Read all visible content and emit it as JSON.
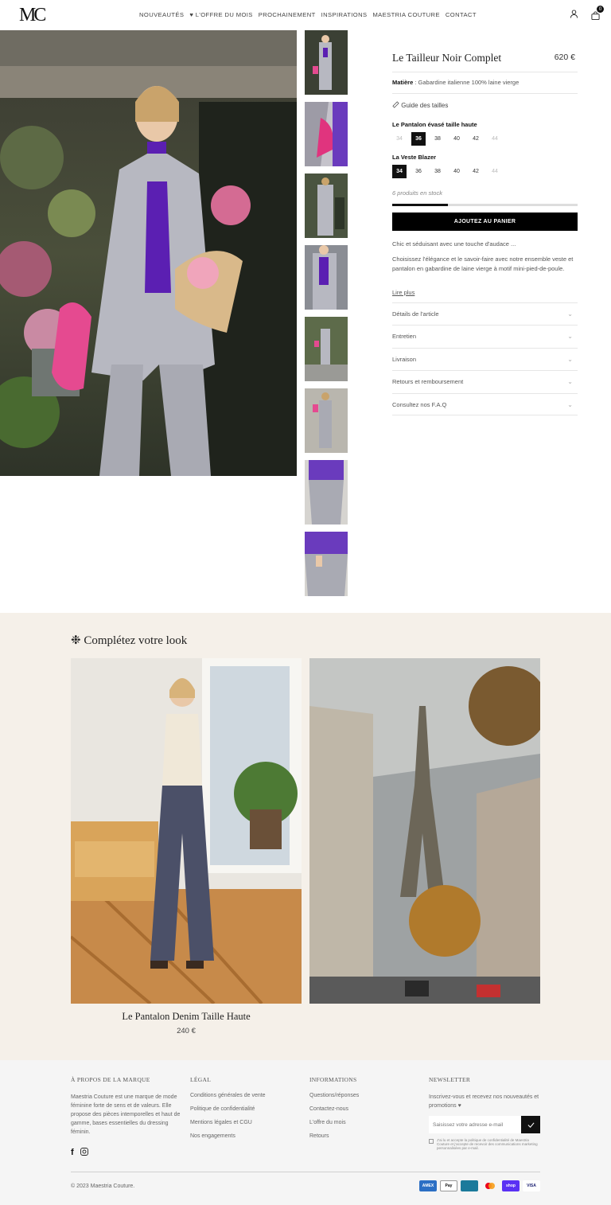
{
  "header": {
    "logo": "MC",
    "nav": [
      "NOUVEAUTÉS",
      "♥ L'OFFRE DU MOIS",
      "PROCHAINEMENT",
      "INSPIRATIONS",
      "MAESTRIA COUTURE",
      "CONTACT"
    ],
    "cart_count": "0"
  },
  "product": {
    "title": "Le Tailleur Noir Complet",
    "price": "620 €",
    "material_label": "Matière",
    "material_value": " : Gabardine italienne 100% laine vierge",
    "size_guide": "Guide des tailles",
    "variant1": {
      "label": "Le Pantalon évasé taille haute",
      "sizes": [
        "34",
        "36",
        "38",
        "40",
        "42",
        "44"
      ],
      "selected": "36",
      "unavailable": [
        "34",
        "44"
      ]
    },
    "variant2": {
      "label": "La Veste Blazer",
      "sizes": [
        "34",
        "36",
        "38",
        "40",
        "42",
        "44"
      ],
      "selected": "34",
      "unavailable": [
        "44"
      ]
    },
    "stock": "6 produits en stock",
    "stock_fraction": 0.3,
    "add_to_cart": "AJOUTEZ AU PANIER",
    "desc_short": "Chic et séduisant avec une touche d'audace ...",
    "desc_long": "Choisissez l'élégance et le savoir-faire avec notre ensemble veste et pantalon en gabardine de laine vierge à motif mini-pied-de-poule.",
    "read_more": "Lire plus",
    "accordion": [
      "Détails de l'article",
      "Entretien",
      "Livraison",
      "Retours et remboursement",
      "Consultez nos F.A.Q"
    ]
  },
  "look": {
    "title": "❉ Complétez votre look",
    "item_name": "Le Pantalon Denim Taille Haute",
    "item_price": "240 €"
  },
  "footer": {
    "about_title": "À PROPOS DE LA MARQUE",
    "about_text": "Maestria Couture est une marque de mode féminine forte de sens et de valeurs. Elle propose des pièces intemporelles et haut de gamme, bases essentielles du dressing féminin.",
    "legal_title": "LÉGAL",
    "legal_links": [
      "Conditions générales de vente",
      "Politique de confidentialité",
      "Mentions légales et CGU",
      "Nos engagements"
    ],
    "info_title": "INFORMATIONS",
    "info_links": [
      "Questions/réponses",
      "Contactez-nous",
      "L'offre du mois",
      "Retours"
    ],
    "newsletter_title": "NEWSLETTER",
    "newsletter_text": "Inscrivez-vous et recevez nos nouveautés et promotions ♥",
    "newsletter_placeholder": "Saisissez votre adresse e-mail",
    "consent": "J'ai lu et accepte la politique de confidentialité de Maestria Couture et j'accepte de recevoir des communications marketing personnalisées par e-mail.",
    "copyright": "© 2023 Maestria Couture.",
    "payments": [
      "AMEX",
      "Pay",
      "",
      "",
      "shop",
      "VISA"
    ]
  }
}
